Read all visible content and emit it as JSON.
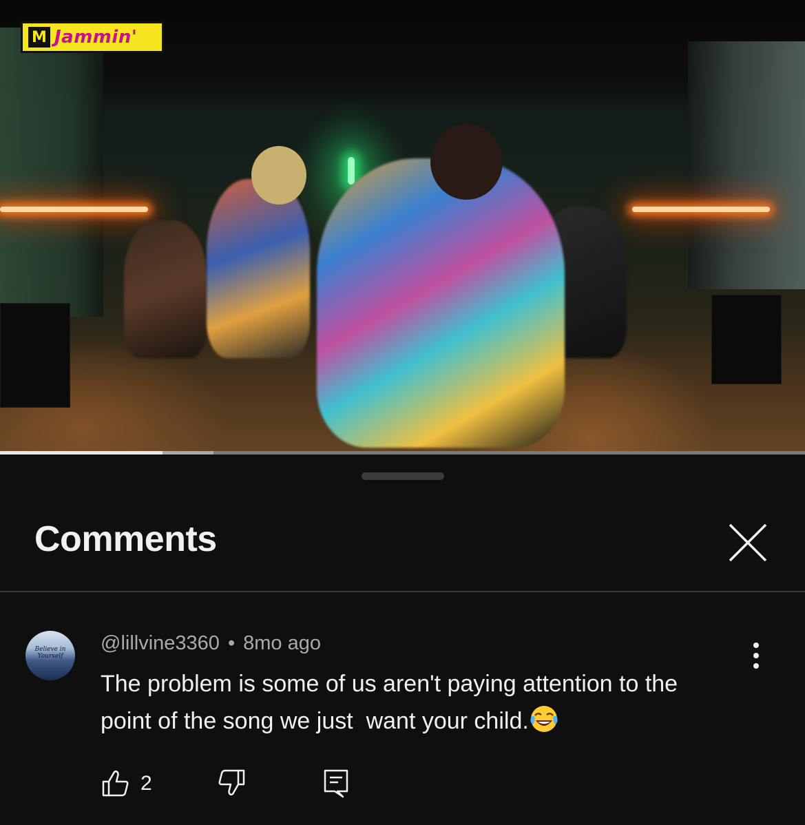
{
  "video": {
    "channel_logo_mark": "M",
    "channel_logo_text": "Jammin'",
    "progress_fraction": 0.202,
    "buffer_fraction": 0.265
  },
  "comments_panel": {
    "title": "Comments",
    "close_icon": "close-icon"
  },
  "comment": {
    "avatar_text": "Believe in Yourself",
    "author": "@lillvine3360",
    "separator": "•",
    "time": "8mo ago",
    "text": "The problem is some of us aren't paying attention to the point of the song we just  want your child.",
    "emoji": "face-with-tears-of-joy",
    "like_count": "2",
    "icons": {
      "like": "thumbs-up-icon",
      "dislike": "thumbs-down-icon",
      "reply": "reply-icon",
      "more": "more-vertical-icon"
    }
  },
  "colors": {
    "background": "#0f0f0f",
    "text_primary": "#f1f1f1",
    "text_secondary": "#aaaaaa",
    "divider": "#3a3a3a",
    "logo_yellow": "#f6e620",
    "logo_magenta": "#c4128a"
  }
}
